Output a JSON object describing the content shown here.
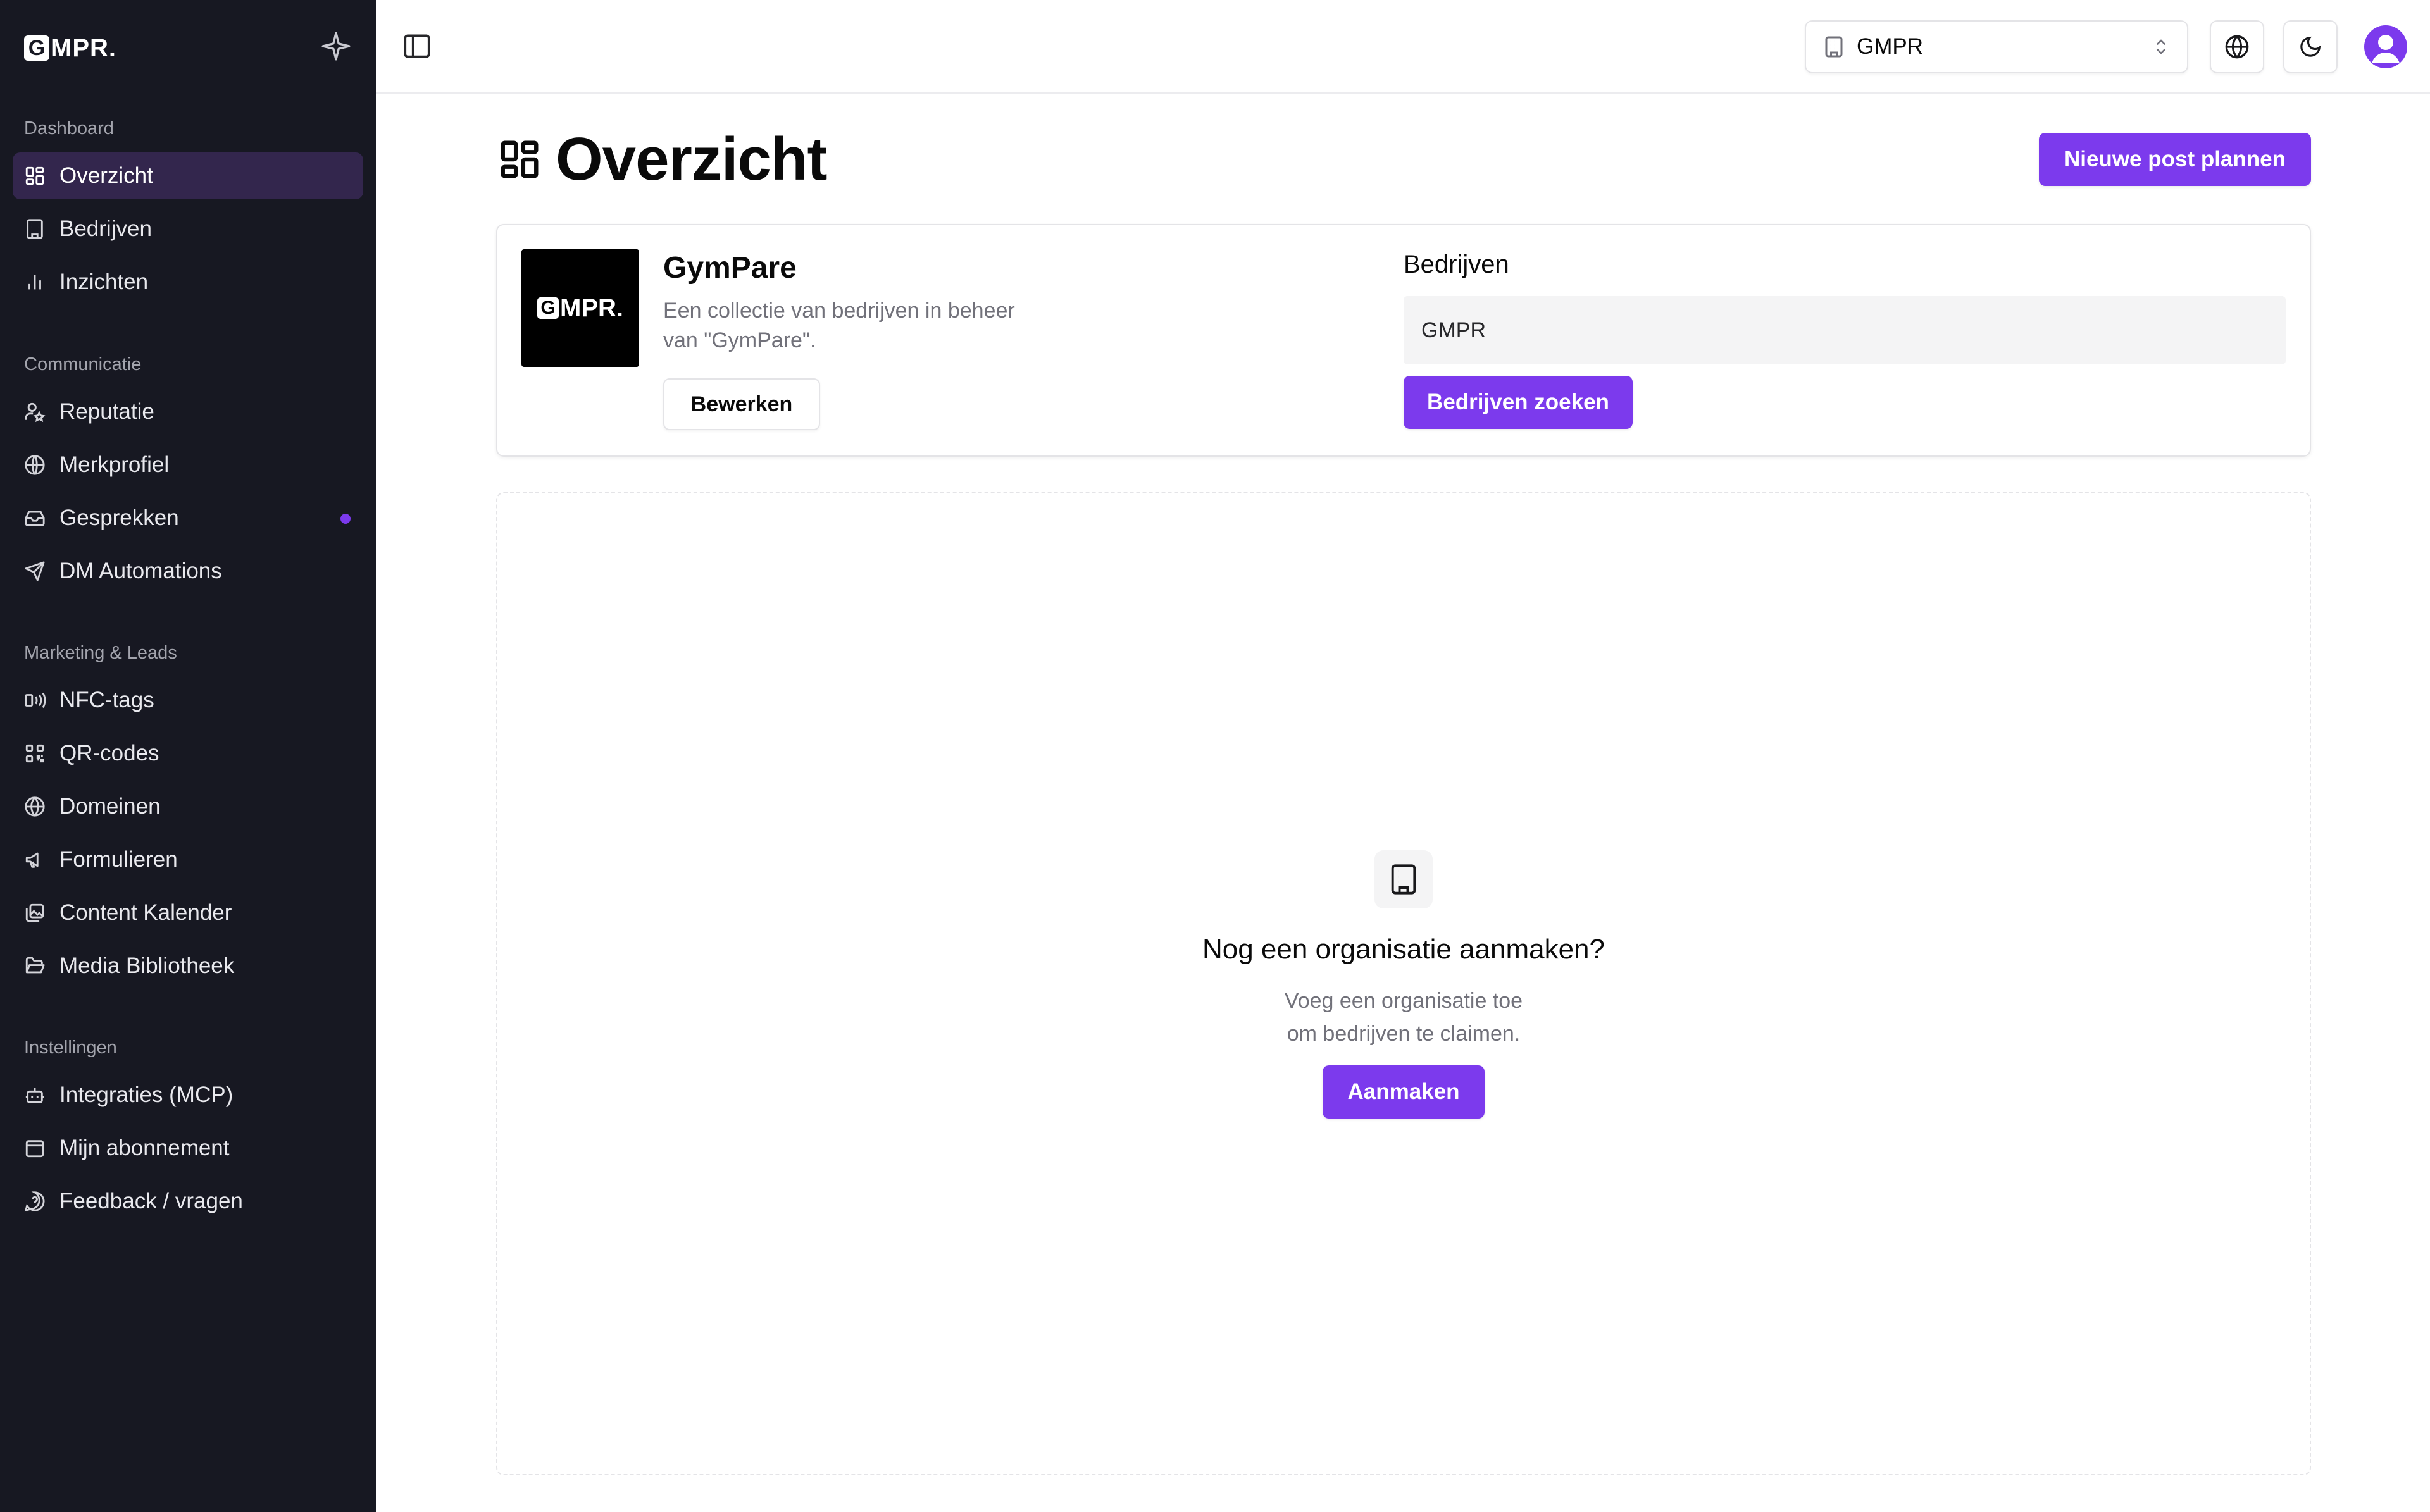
{
  "sidebar": {
    "logo_mark": "G",
    "logo_text": "MPR.",
    "sections": [
      {
        "label": "Dashboard",
        "items": [
          {
            "label": "Overzicht",
            "icon": "layout-grid-icon",
            "active": true
          },
          {
            "label": "Bedrijven",
            "icon": "building-icon"
          },
          {
            "label": "Inzichten",
            "icon": "bar-chart-icon"
          }
        ]
      },
      {
        "label": "Communicatie",
        "items": [
          {
            "label": "Reputatie",
            "icon": "user-star-icon"
          },
          {
            "label": "Merkprofiel",
            "icon": "globe-grid-icon"
          },
          {
            "label": "Gesprekken",
            "icon": "inbox-icon",
            "badge_dot": true
          },
          {
            "label": "DM Automations",
            "icon": "send-icon"
          }
        ]
      },
      {
        "label": "Marketing & Leads",
        "items": [
          {
            "label": "NFC-tags",
            "icon": "nfc-icon"
          },
          {
            "label": "QR-codes",
            "icon": "qr-code-icon"
          },
          {
            "label": "Domeinen",
            "icon": "globe-icon"
          },
          {
            "label": "Formulieren",
            "icon": "megaphone-icon"
          },
          {
            "label": "Content Kalender",
            "icon": "image-stack-icon"
          },
          {
            "label": "Media Bibliotheek",
            "icon": "folder-open-icon"
          }
        ]
      },
      {
        "label": "Instellingen",
        "items": [
          {
            "label": "Integraties (MCP)",
            "icon": "bot-icon"
          },
          {
            "label": "Mijn abonnement",
            "icon": "calendar-icon"
          },
          {
            "label": "Feedback / vragen",
            "icon": "help-circle-icon"
          }
        ]
      }
    ]
  },
  "topbar": {
    "org_select_value": "GMPR",
    "icons": [
      "panel-left-icon",
      "globe-icon",
      "moon-icon",
      "user-avatar-icon"
    ]
  },
  "main": {
    "title": "Overzicht",
    "new_post_button": "Nieuwe post plannen",
    "org_card": {
      "logo_mark": "G",
      "logo_text": "MPR.",
      "name": "GymPare",
      "description": "Een collectie van bedrijven in beheer van \"GymPare\".",
      "edit_button": "Bewerken",
      "bedrijven_label": "Bedrijven",
      "bedrijven_value": "GMPR",
      "search_button": "Bedrijven zoeken"
    },
    "empty_state": {
      "title": "Nog een organisatie aanmaken?",
      "description_line1": "Voeg een organisatie toe",
      "description_line2": "om bedrijven te claimen.",
      "button": "Aanmaken"
    }
  },
  "colors": {
    "sidebar_bg": "#171822",
    "accent": "#7c3aed",
    "active_item_bg": "#33264d"
  }
}
